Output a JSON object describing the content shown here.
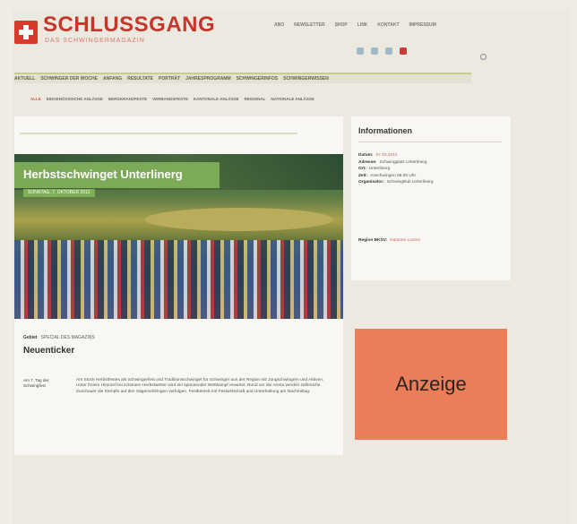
{
  "header": {
    "title": "SCHLUSSGANG",
    "subtitle": "DAS SCHWINGERMAGAZIN",
    "topnav": [
      "ABO",
      "NEWSLETTER",
      "SHOP",
      "LINK",
      "KONTAKT",
      "IMPRESSUM"
    ]
  },
  "mainnav": {
    "items": [
      "AKTUELL",
      "SCHWINGER DER WOCHE",
      "ANFANG",
      "RESULTATE",
      "PORTRÄT",
      "JAHRESPROGRAMM",
      "SCHWINGERINFOS",
      "SCHWINGERWISSEN"
    ]
  },
  "subnav": {
    "items": [
      "ALLE",
      "EIDGENÖSSISCHE ANLÄSSE",
      "BERGKRANZFESTE",
      "VERBANDSFESTE",
      "KANTONALE ANLÄSSE",
      "REGIONAL",
      "NATIONALE ANLÄSSE"
    ]
  },
  "article": {
    "title": "Herbstschwinget Unterlinerg",
    "date": "SONNTAG, 7. OKTOBER 2012",
    "kicker_label": "Gebiet",
    "kicker_value": "SPECIAL DES MAGAZINS",
    "heading": "Neuenticker",
    "meta": "Am 7. Tag der Schwingfest",
    "body": "Am Stück Herbstfestes als Schwingerfest und Traditionsschwinget für Schwinger aus der Region mit Jungschwingern und Aktiven. Unter freiem Himmel bei schönem Herbstwetter wird ein spannender Wettkampf erwartet. Rund um die Arena werden zahlreiche Zuschauer die Kämpfe auf den Sägemehlringen verfolgen. Festbetrieb mit Festwirtschaft und Unterhaltung am Nachmittag."
  },
  "info": {
    "title": "Informationen",
    "rows": [
      {
        "label": "Datum:",
        "value": "07.10.2012"
      },
      {
        "label": "Adresse:",
        "value": "Schwingplatz Unterlinerg"
      },
      {
        "label": "Ort:",
        "value": "Unterlinerg"
      },
      {
        "label": "Zeit:",
        "value": "Anschwingen 08.00 Uhr"
      },
      {
        "label": "Organisator:",
        "value": "Schwingklub Unterlinerg"
      }
    ],
    "last_label": "Region BKSV:",
    "last_value": "Kantone Luzern"
  },
  "ad": {
    "label": "Anzeige"
  }
}
